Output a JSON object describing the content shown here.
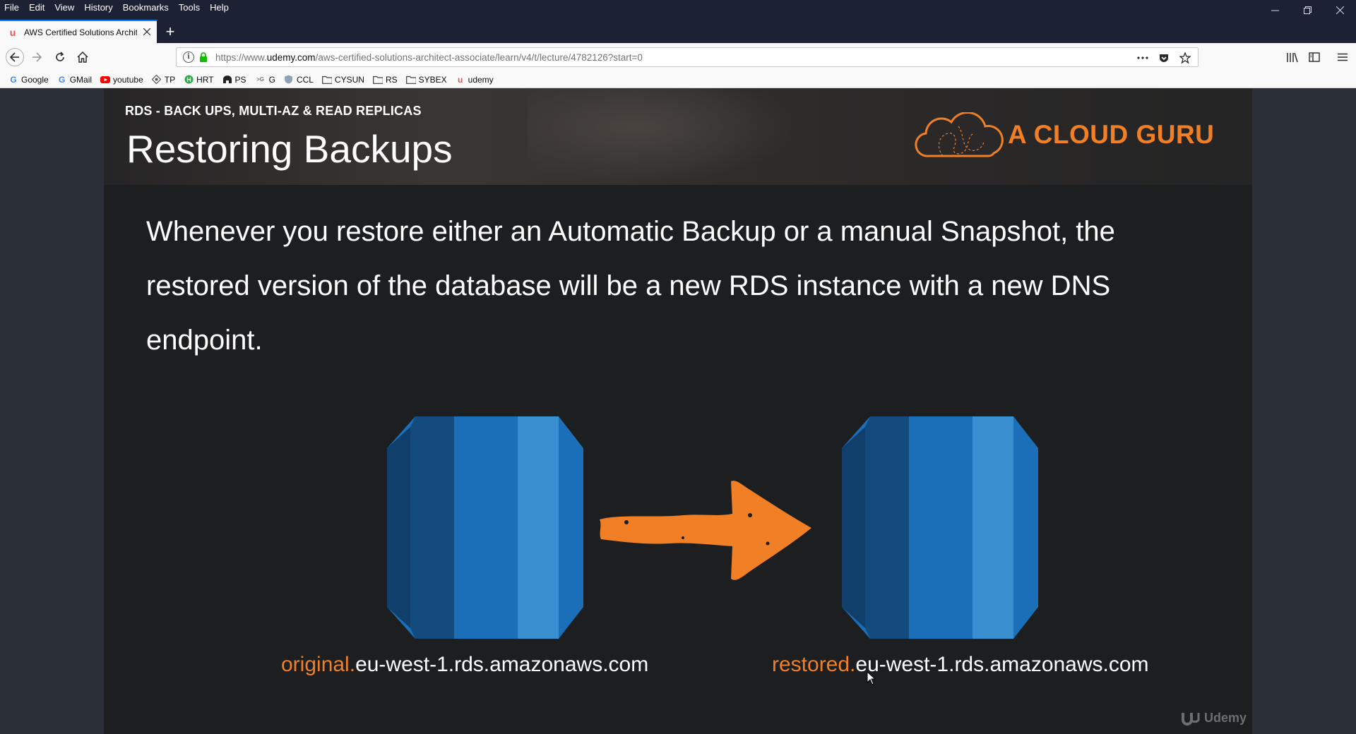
{
  "menu": [
    "File",
    "Edit",
    "View",
    "History",
    "Bookmarks",
    "Tools",
    "Help"
  ],
  "tab": {
    "title": "AWS Certified Solutions Architect",
    "new_tab_label": "+"
  },
  "url": {
    "prefix": "https://www.",
    "domain": "udemy.com",
    "path": "/aws-certified-solutions-architect-associate/learn/v4/t/lecture/4782126?start=0"
  },
  "bookmarks": [
    {
      "label": "Google",
      "icon": "google-icon"
    },
    {
      "label": "GMail",
      "icon": "google-icon"
    },
    {
      "label": "youtube",
      "icon": "youtube-icon"
    },
    {
      "label": "TP",
      "icon": "tp-icon"
    },
    {
      "label": "HRT",
      "icon": "hrt-icon"
    },
    {
      "label": "PS",
      "icon": "ps-icon"
    },
    {
      "label": "G",
      "icon": "g-icon"
    },
    {
      "label": "CCL",
      "icon": "ccl-icon"
    },
    {
      "label": "CYSUN",
      "icon": "folder-icon"
    },
    {
      "label": "RS",
      "icon": "folder-icon"
    },
    {
      "label": "SYBEX",
      "icon": "folder-icon"
    },
    {
      "label": "udemy",
      "icon": "udemy-icon"
    }
  ],
  "slide": {
    "section": "RDS - BACK UPS, MULTI-AZ & READ REPLICAS",
    "title": "Restoring Backups",
    "brand": "A CLOUD GURU",
    "body": "Whenever you restore either an Automatic Backup or a manual Snapshot, the restored version of the database will be a new RDS instance with a new DNS endpoint.",
    "original_prefix": "original.",
    "original_suffix": "eu-west-1.rds.amazonaws.com",
    "restored_prefix": "restored.",
    "restored_suffix": "eu-west-1.rds.amazonaws.com",
    "watermark": "Udemy"
  },
  "colors": {
    "accent_orange": "#f07f26",
    "db_blue_dark": "#134b7e",
    "db_blue_mid": "#1a6fb8",
    "db_blue_light": "#3a8fd0"
  }
}
